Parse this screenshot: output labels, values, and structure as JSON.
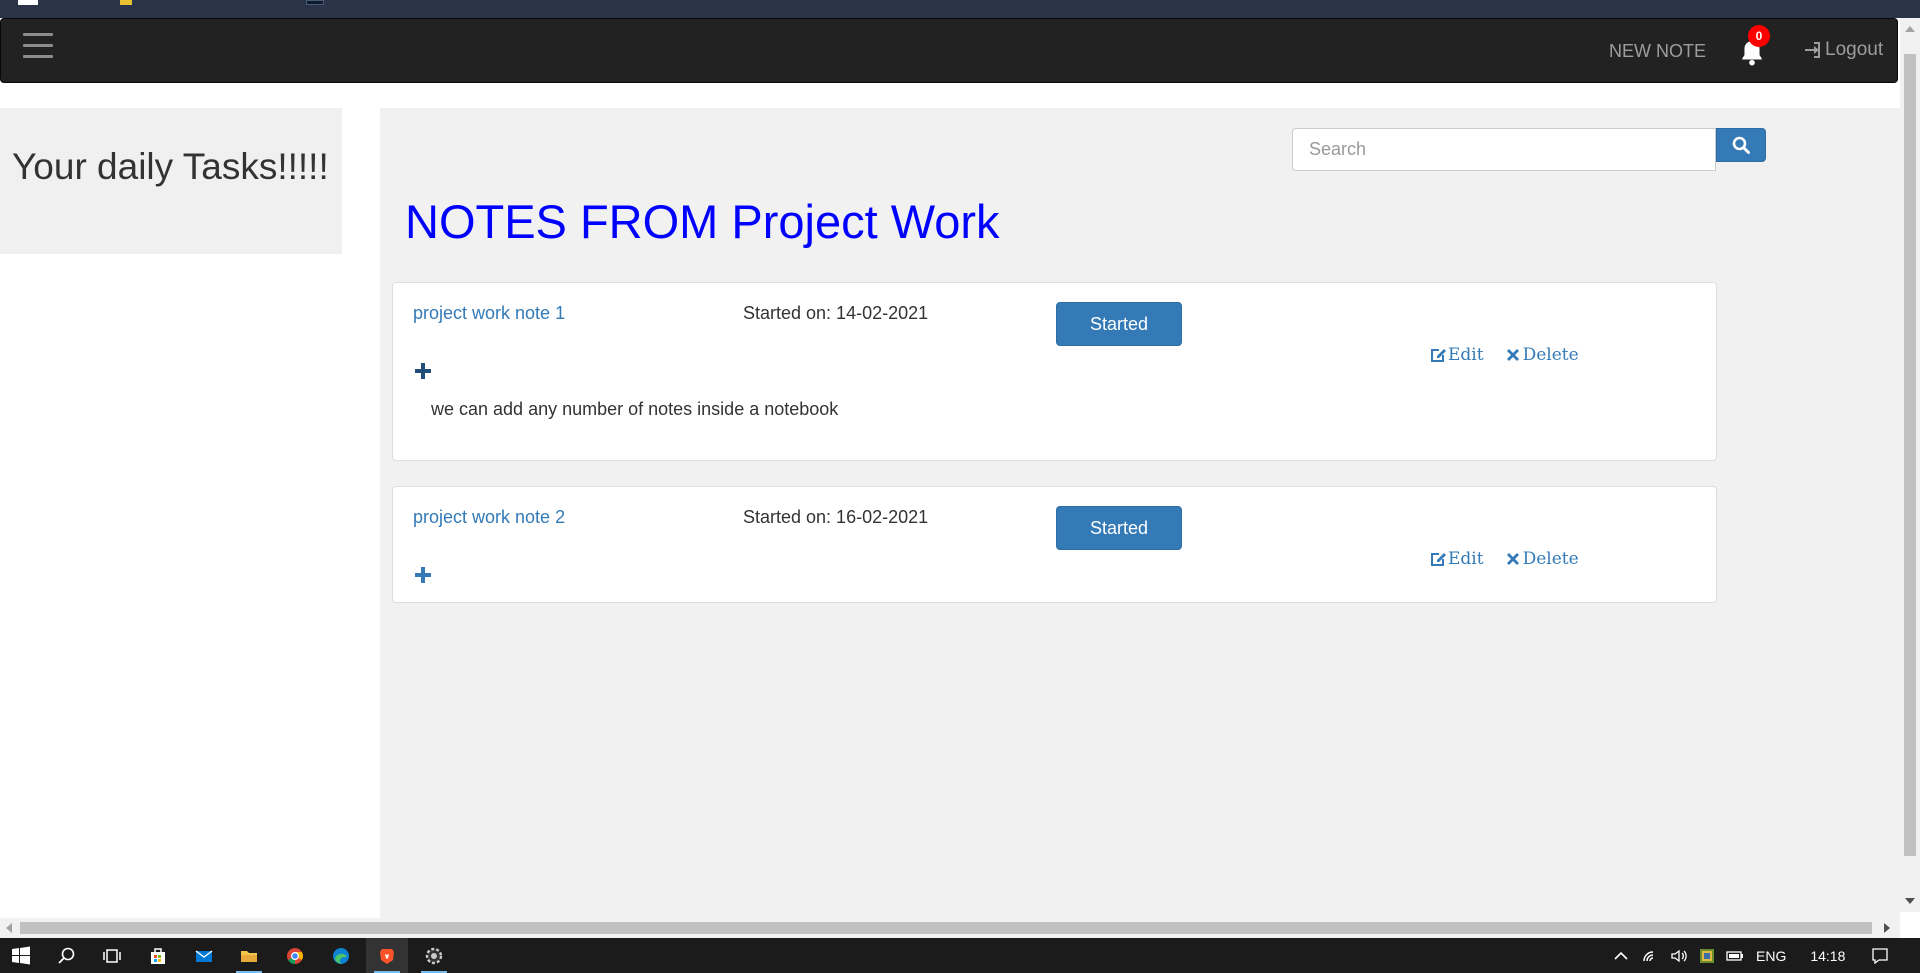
{
  "navbar": {
    "new_note_label": "NEW NOTE",
    "notification_count": "0",
    "logout_label": "Logout"
  },
  "sidebar": {
    "heading": "Your daily Tasks!!!!!"
  },
  "search": {
    "placeholder": "Search"
  },
  "main": {
    "title": "NOTES FROM Project Work",
    "notes": [
      {
        "title": "project work note 1",
        "date": "Started on: 14-02-2021",
        "status": "Started",
        "edit_label": "Edit",
        "delete_label": "Delete",
        "body": "we can add any number of notes inside a notebook"
      },
      {
        "title": "project work note 2",
        "date": "Started on: 16-02-2021",
        "status": "Started",
        "edit_label": "Edit",
        "delete_label": "Delete",
        "body": ""
      }
    ]
  },
  "taskbar": {
    "icons": [
      "windows-start-icon",
      "search-icon",
      "task-view-icon",
      "store-icon",
      "mail-icon",
      "file-explorer-icon",
      "chrome-icon",
      "edge-icon",
      "brave-icon",
      "settings-app-icon"
    ],
    "language": "ENG",
    "time": "14:18"
  },
  "colors": {
    "navbar_bg": "#222222",
    "accent": "#337ab7",
    "title": "#0000ff",
    "badge": "#ff0000",
    "panel_bg": "#f1f1f1"
  }
}
